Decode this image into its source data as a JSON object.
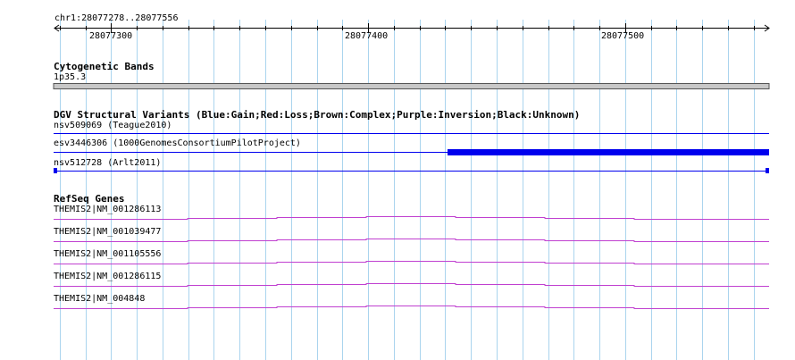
{
  "ruler": {
    "location": "chr1:28077278..28077556",
    "start": 28077278,
    "end": 28077556,
    "major_ticks": [
      {
        "pos": 28077300,
        "label": "28077300"
      },
      {
        "pos": 28077400,
        "label": "28077400"
      },
      {
        "pos": 28077500,
        "label": "28077500"
      }
    ]
  },
  "colors": {
    "gridline": "#aad4ee",
    "axis": "#000000",
    "band_fill": "#c8c8c8",
    "band_border": "#555555",
    "dgv_blue": "#0000ee",
    "refseq_magenta": "#c040d0"
  },
  "tracks": {
    "cytobands": {
      "title": "Cytogenetic Bands",
      "band_label": "1p35.3"
    },
    "dgv": {
      "title": "DGV Structural Variants (Blue:Gain;Red:Loss;Brown:Complex;Purple:Inversion;Black:Unknown)",
      "features": [
        {
          "label": "nsv509069 (Teague2010)"
        },
        {
          "label": "esv3446306 (1000GenomesConsortiumPilotProject)",
          "thick_start": 28077431
        },
        {
          "label": "nsv512728 (Arlt2011)"
        }
      ]
    },
    "refseq": {
      "title": "RefSeq Genes",
      "genes": [
        {
          "label": "THEMIS2|NM_001286113"
        },
        {
          "label": "THEMIS2|NM_001039477"
        },
        {
          "label": "THEMIS2|NM_001105556"
        },
        {
          "label": "THEMIS2|NM_001286115"
        },
        {
          "label": "THEMIS2|NM_004848"
        }
      ]
    }
  }
}
